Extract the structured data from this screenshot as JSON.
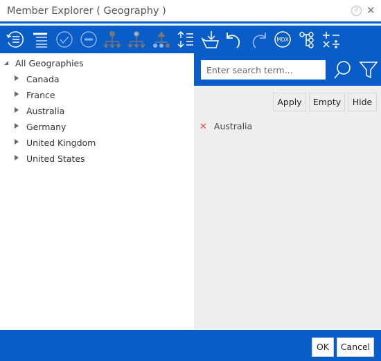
{
  "window": {
    "title": "Member Explorer ( Geography )",
    "help_icon": "question-circle-icon",
    "close_icon": "close-icon"
  },
  "toolbar": {
    "icons": [
      "reset-list-icon",
      "list-icon",
      "check-circle-icon",
      "minus-circle-icon",
      "hierarchy-children-icon",
      "hierarchy-descendants-icon",
      "hierarchy-parent-icon",
      "expand-collapse-icon",
      "load-icon",
      "undo-icon",
      "redo-icon",
      "mdx-icon",
      "tree-nodes-icon",
      "calculation-icon"
    ],
    "mdx_label": "MDX"
  },
  "tree": {
    "root": "All Geographies",
    "children": [
      "Canada",
      "France",
      "Australia",
      "Germany",
      "United Kingdom",
      "United States"
    ]
  },
  "search": {
    "placeholder": "Enter search term...",
    "value": ""
  },
  "actions": {
    "apply": "Apply",
    "empty": "Empty",
    "hide": "Hide"
  },
  "selected": [
    {
      "label": "Australia",
      "remove_icon": "remove-x-icon"
    }
  ],
  "footer": {
    "ok": "OK",
    "cancel": "Cancel"
  },
  "colors": {
    "accent": "#0a5cc6"
  }
}
